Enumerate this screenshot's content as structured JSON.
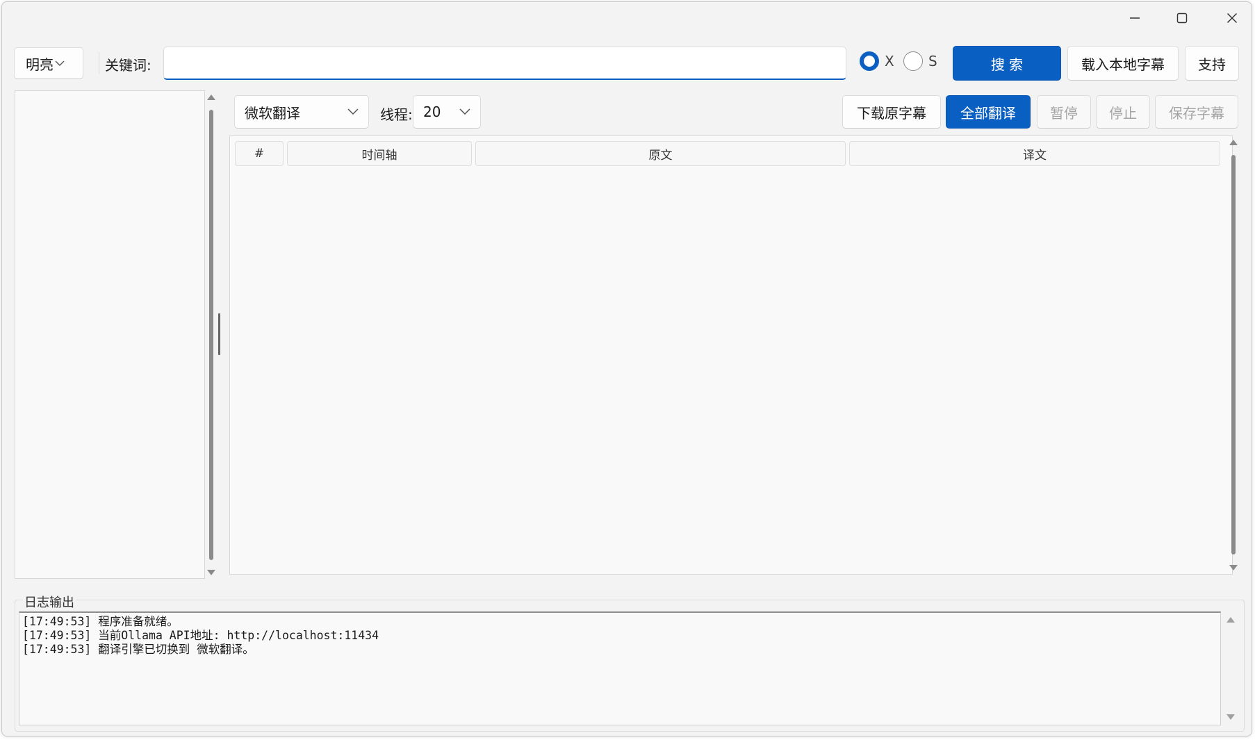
{
  "window_controls": {
    "minimize": "minimize-icon",
    "maximize": "maximize-icon",
    "close": "close-icon"
  },
  "toolbar": {
    "theme_select": "明亮",
    "keyword_label": "关键词:",
    "keyword_value": "",
    "radio_options": [
      {
        "label": "X",
        "checked": true
      },
      {
        "label": "S",
        "checked": false
      }
    ],
    "search_button": "搜 索",
    "load_local_button": "载入本地字幕",
    "support_button": "支持"
  },
  "translate_bar": {
    "engine_select": "微软翻译",
    "threads_label": "线程:",
    "threads_value": "20",
    "download_button": "下载原字幕",
    "translate_all_button": "全部翻译",
    "pause_button": "暂停",
    "stop_button": "停止",
    "save_button": "保存字幕"
  },
  "table": {
    "columns": [
      "#",
      "时间轴",
      "原文",
      "译文"
    ],
    "rows": []
  },
  "log": {
    "title": "日志输出",
    "lines": [
      "[17:49:53] 程序准备就绪。",
      "[17:49:53] 当前Ollama API地址: http://localhost:11434",
      "[17:49:53] 翻译引擎已切换到 微软翻译。"
    ]
  },
  "colors": {
    "accent": "#0a5fc2",
    "background": "#f3f3f3",
    "disabled_text": "#a4a4a4"
  }
}
